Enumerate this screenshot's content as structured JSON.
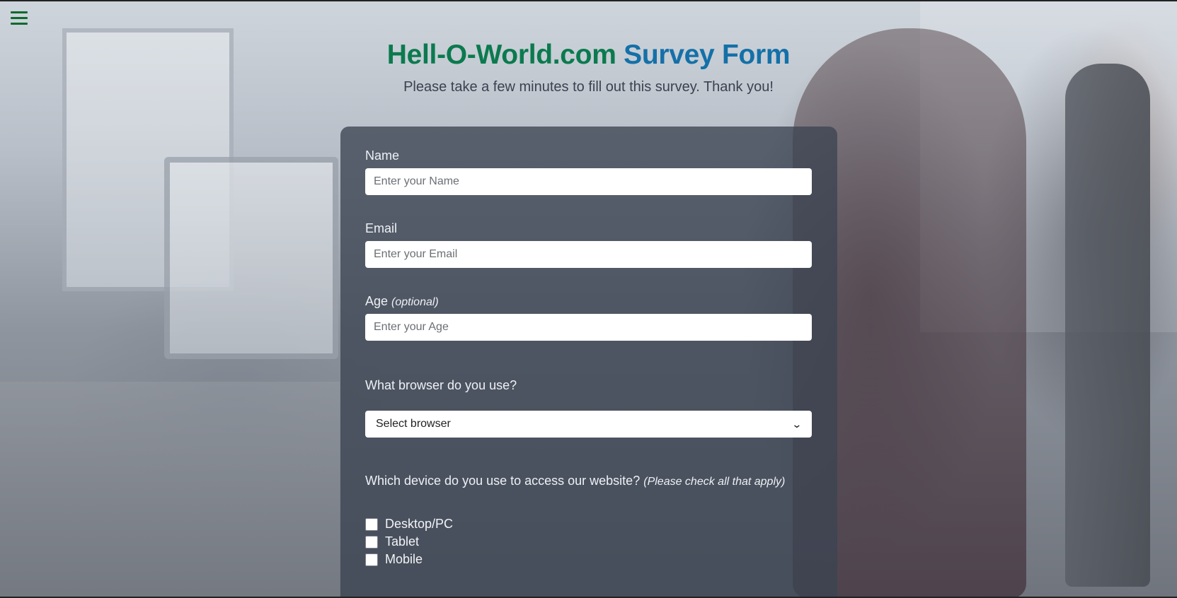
{
  "header": {
    "title_part1": "Hell-O-World.com",
    "title_part2": "Survey Form",
    "subtitle": "Please take a few minutes to fill out this survey. Thank you!"
  },
  "colors": {
    "title_green": "#0b7a4e",
    "title_blue": "#1470a8",
    "menu_icon": "#0a6b2c"
  },
  "menu": {
    "icon": "hamburger-menu-icon"
  },
  "form": {
    "name": {
      "label": "Name",
      "placeholder": "Enter your Name",
      "value": ""
    },
    "email": {
      "label": "Email",
      "placeholder": "Enter your Email",
      "value": ""
    },
    "age": {
      "label": "Age",
      "label_note": "(optional)",
      "placeholder": "Enter your Age",
      "value": ""
    },
    "browser": {
      "question": "What browser do you use?",
      "selected": "Select browser"
    },
    "device": {
      "question": "Which device do you use to access our website?",
      "note": "(Please check all that apply)",
      "options": [
        {
          "label": "Desktop/PC",
          "checked": false
        },
        {
          "label": "Tablet",
          "checked": false
        },
        {
          "label": "Mobile",
          "checked": false
        }
      ]
    }
  }
}
